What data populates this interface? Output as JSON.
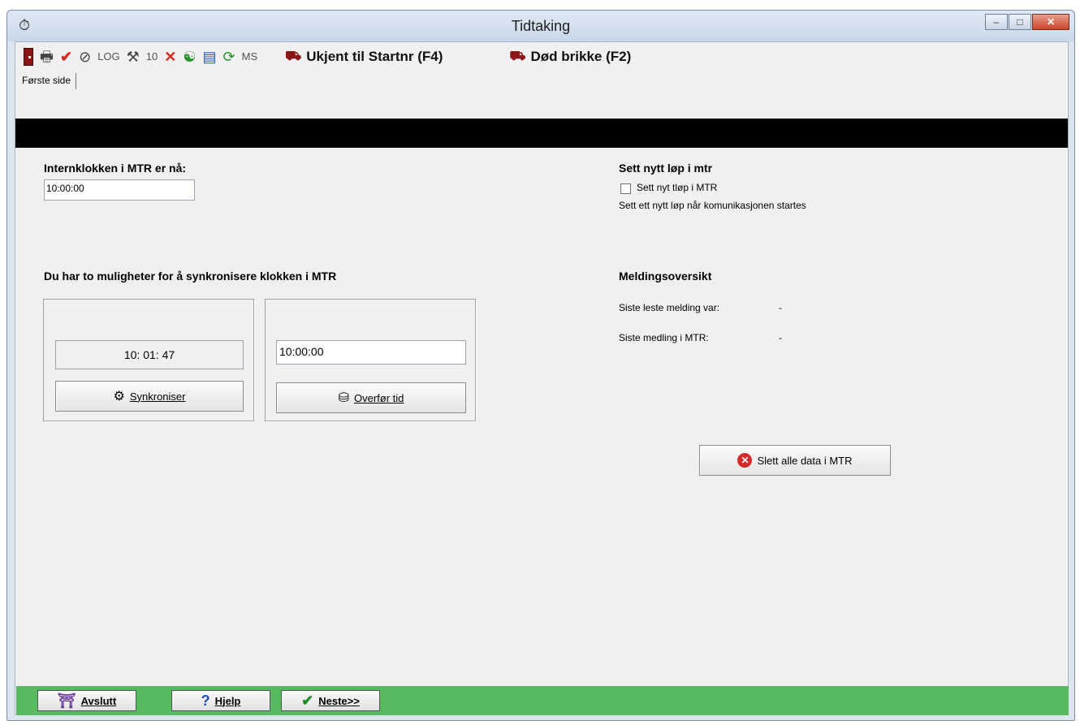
{
  "window": {
    "title": "Tidtaking",
    "controls": {
      "minimize": "–",
      "maximize": "□",
      "close": "✕"
    }
  },
  "toolbar": {
    "items": [
      {
        "icon": "door-exit-icon"
      },
      {
        "icon": "printer-icon",
        "glyph": "🖶"
      },
      {
        "icon": "checkmark-icon",
        "glyph": "✔"
      },
      {
        "icon": "cancel-icon",
        "glyph": "⊘"
      },
      {
        "icon": "log-icon",
        "label": "LOG"
      },
      {
        "icon": "tools-icon",
        "glyph": "⚒"
      },
      {
        "icon": "count-icon",
        "label": "10"
      },
      {
        "icon": "delete-icon",
        "glyph": "✕"
      },
      {
        "icon": "fingerprint-icon",
        "glyph": "☯"
      },
      {
        "icon": "card-icon",
        "glyph": "▤"
      },
      {
        "icon": "refresh-icon",
        "glyph": "⟳"
      },
      {
        "icon": "ms-icon",
        "label": "MS"
      }
    ],
    "unknown_to_startnr": "Ukjent til Startnr (F4)",
    "dead_chip": "Død brikke (F2)",
    "car_glyph": "⛟"
  },
  "tabs": {
    "first_page": "Første side"
  },
  "clock": {
    "heading": "Internklokken i MTR er nå:",
    "value": "10:00:00"
  },
  "sync": {
    "heading": "Du har to muligheter for å synkronisere klokken i MTR",
    "current_time": "10: 01: 47",
    "sync_button": "Synkroniser",
    "transfer_value": "10:00:00",
    "transfer_button": "Overfør tid"
  },
  "new_race": {
    "heading": "Sett nytt løp i mtr",
    "checkbox_label": "Sett nyt tløp i MTR",
    "description": "Sett ett nytt løp når komunikasjonen startes"
  },
  "messages": {
    "heading": "Meldingsoversikt",
    "last_read_label": "Siste leste melding var:",
    "last_read_value": "-",
    "last_mtr_label": "Siste medling i MTR:",
    "last_mtr_value": "-"
  },
  "delete_button": "Slett alle data i MTR",
  "footer": {
    "exit": "Avslutt",
    "help": "Hjelp",
    "next": "Neste>>"
  }
}
